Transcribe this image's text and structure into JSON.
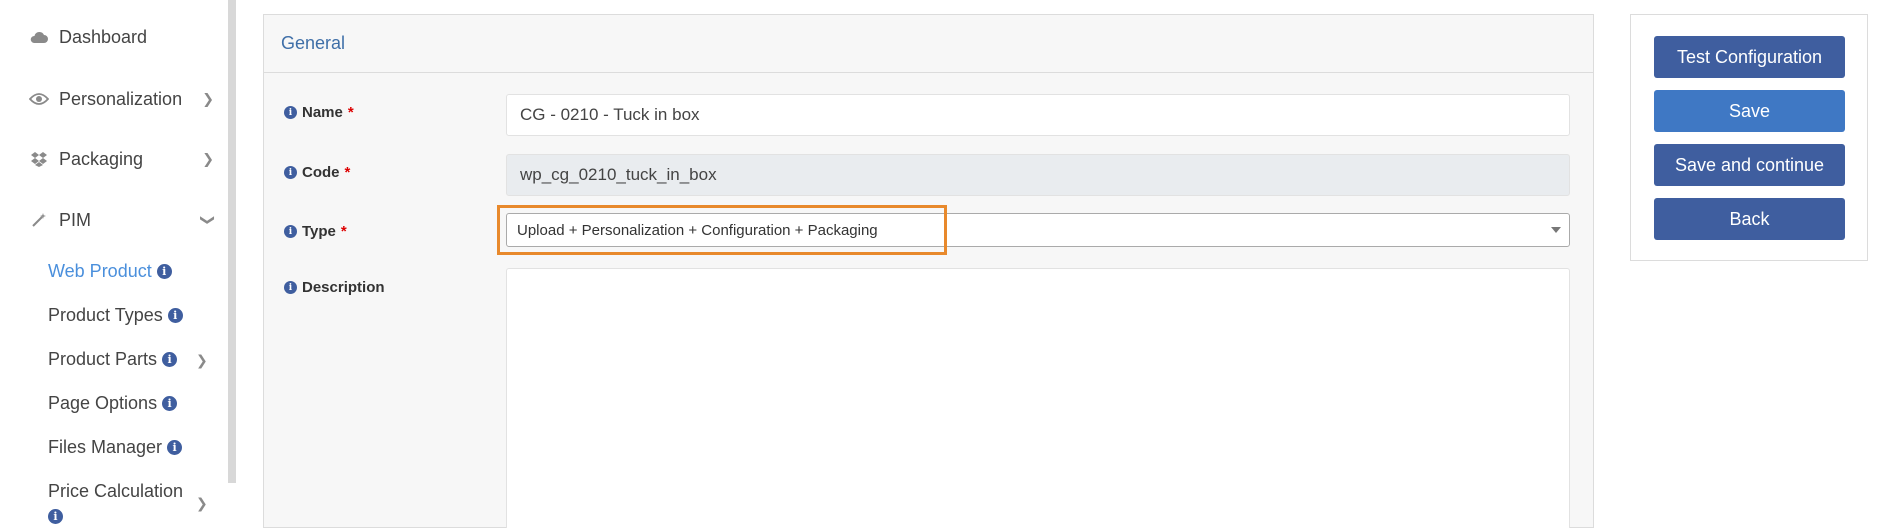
{
  "sidebar": {
    "items": [
      {
        "label": "Dashboard",
        "icon": "cloud-icon"
      },
      {
        "label": "Personalization",
        "icon": "eye-icon"
      },
      {
        "label": "Packaging",
        "icon": "dropbox-icon"
      },
      {
        "label": "PIM",
        "icon": "magic-wand-icon"
      }
    ],
    "pim_sub": [
      {
        "label": "Web Product"
      },
      {
        "label": "Product Types"
      },
      {
        "label": "Product Parts"
      },
      {
        "label": "Page Options"
      },
      {
        "label": "Files Manager"
      },
      {
        "label": "Price Calculation"
      }
    ]
  },
  "panel": {
    "title": "General",
    "fields": {
      "name": {
        "label": "Name",
        "value": "CG - 0210 - Tuck in box"
      },
      "code": {
        "label": "Code",
        "value": "wp_cg_0210_tuck_in_box"
      },
      "type": {
        "label": "Type",
        "value": "Upload + Personalization + Configuration + Packaging"
      },
      "description": {
        "label": "Description",
        "value": ""
      }
    },
    "required_mark": "*"
  },
  "actions": {
    "test_configuration": "Test Configuration",
    "save": "Save",
    "save_continue": "Save and continue",
    "back": "Back"
  },
  "colors": {
    "accent": "#3f5e9f",
    "primary": "#3f78c4",
    "active_link": "#4a8fdc",
    "highlight": "#e8892c"
  }
}
